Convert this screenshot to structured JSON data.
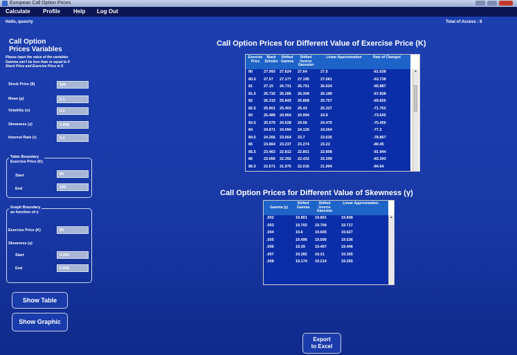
{
  "window": {
    "title": "European Call Option Prices"
  },
  "menu": [
    "Calculate",
    "Profile",
    "Help",
    "Log Out"
  ],
  "greeting": "Hello,   quesrty",
  "total_access": "Total of Access :  8",
  "left": {
    "title_line1": "Call Option",
    "title_line2": "Prices Variables",
    "instruction_line1": "Please input the value of the variables",
    "instruction_line2": "Gamma can't be less than or equal to 0",
    "instruction_line3": "Stock Price and Exercise Price in $",
    "fields": [
      {
        "label": "Stock Price ($)",
        "value": "100"
      },
      {
        "label": "Mean (μ)",
        "value": "0.1"
      },
      {
        "label": "Volatility (σ)",
        "value": "0.2"
      },
      {
        "label": "Skewness (γ)",
        "value": "0.008"
      },
      {
        "label": "Interest Rate (r)",
        "value": "0.1"
      }
    ],
    "table_boundary": {
      "title_line1": "Table Boundary",
      "title_line2": "Exercise Price (K)",
      "start_label": "Start",
      "start_value": "80",
      "end_label": "End",
      "end_value": "100"
    },
    "graph_boundary": {
      "title_line1": "Graph Boundary",
      "title_line2": "as function of γ",
      "exercise_label": "Exercise Price (K)",
      "exercise_value": "90",
      "skewness_label": "Skewness (γ)",
      "start_label": "Start",
      "start_value": "0.002",
      "end_label": "End",
      "end_value": "0.008"
    },
    "show_table": "Show Table",
    "show_graphic": "Show Graphic"
  },
  "table1": {
    "title": "Call Option Prices for Different Value of Exercise Price (K)",
    "headers": [
      "Exercise Price",
      "Black Scholes",
      "Shifted Gamma",
      "Shifted Inverse Gaussian",
      "Linear Approximation",
      "Rate of Changed"
    ],
    "rows": [
      [
        "80",
        "27.993",
        "27.624",
        "27.64",
        "27.5",
        "-61.638"
      ],
      [
        "80.5",
        "27.57",
        "27.177",
        "27.195",
        "27.061",
        "-63.738"
      ],
      [
        "81",
        "27.15",
        "26.731",
        "26.751",
        "26.624",
        "-65.887"
      ],
      [
        "81.5",
        "26.732",
        "26.286",
        "26.309",
        "26.189",
        "-67.838"
      ],
      [
        "82",
        "26.315",
        "25.843",
        "25.868",
        "25.757",
        "-69.825"
      ],
      [
        "82.5",
        "25.901",
        "25.403",
        "25.43",
        "25.327",
        "-71.762"
      ],
      [
        "83",
        "25.489",
        "24.964",
        "24.994",
        "24.9",
        "-73.645"
      ],
      [
        "83.5",
        "25.079",
        "24.528",
        "24.56",
        "24.475",
        "-75.456"
      ],
      [
        "84",
        "24.671",
        "24.094",
        "24.129",
        "24.054",
        "-77.2"
      ],
      [
        "84.5",
        "24.266",
        "23.664",
        "23.7",
        "23.635",
        "-78.867"
      ],
      [
        "85",
        "23.864",
        "23.237",
        "23.274",
        "23.22",
        "-80.45"
      ],
      [
        "85.5",
        "23.463",
        "22.812",
        "22.851",
        "22.808",
        "-81.944"
      ],
      [
        "86",
        "23.066",
        "22.392",
        "22.432",
        "22.399",
        "-83.343"
      ],
      [
        "86.5",
        "22.671",
        "21.975",
        "22.016",
        "21.994",
        "-84.64"
      ]
    ]
  },
  "table2": {
    "title": "Call Option Prices for Different Value of Skewness (γ)",
    "headers": [
      "Gamma (γ)",
      "Shifted Gamma",
      "Shifted Inverse Gaussian",
      "Linear Approximation"
    ],
    "rows": [
      [
        ".002",
        "19.801",
        "19.801",
        "19.808"
      ],
      [
        ".003",
        "19.702",
        "19.704",
        "19.717"
      ],
      [
        ".004",
        "19.6",
        "19.605",
        "19.627"
      ],
      [
        ".005",
        "19.496",
        "19.506",
        "19.536"
      ],
      [
        ".006",
        "19.39",
        "19.407",
        "19.446"
      ],
      [
        ".007",
        "19.282",
        "19.31",
        "19.355"
      ],
      [
        ".008",
        "19.174",
        "19.214",
        "19.265"
      ]
    ]
  },
  "export_line1": "Export",
  "export_line2": "to Excel"
}
